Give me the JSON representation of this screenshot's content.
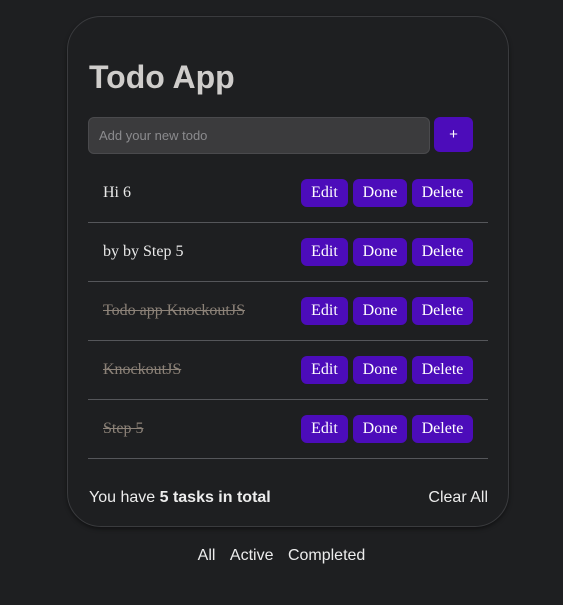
{
  "app": {
    "title": "Todo App"
  },
  "input": {
    "placeholder": "Add your new todo",
    "value": "",
    "add_label": "+"
  },
  "buttons": {
    "edit": "Edit",
    "done": "Done",
    "delete": "Delete"
  },
  "todos": [
    {
      "text": "Hi 6",
      "completed": false
    },
    {
      "text": "by by Step 5",
      "completed": false
    },
    {
      "text": "Todo app KnockoutJS",
      "completed": true
    },
    {
      "text": "KnockoutJS",
      "completed": true
    },
    {
      "text": "Step 5",
      "completed": true
    }
  ],
  "footer": {
    "prefix": "You have ",
    "count_text": "5 tasks in total",
    "clear_label": "Clear All"
  },
  "filters": {
    "all": "All",
    "active": "Active",
    "completed": "Completed"
  },
  "colors": {
    "accent": "#4c0cba",
    "background": "#1e1f21",
    "completed_text": "#8c8278"
  }
}
